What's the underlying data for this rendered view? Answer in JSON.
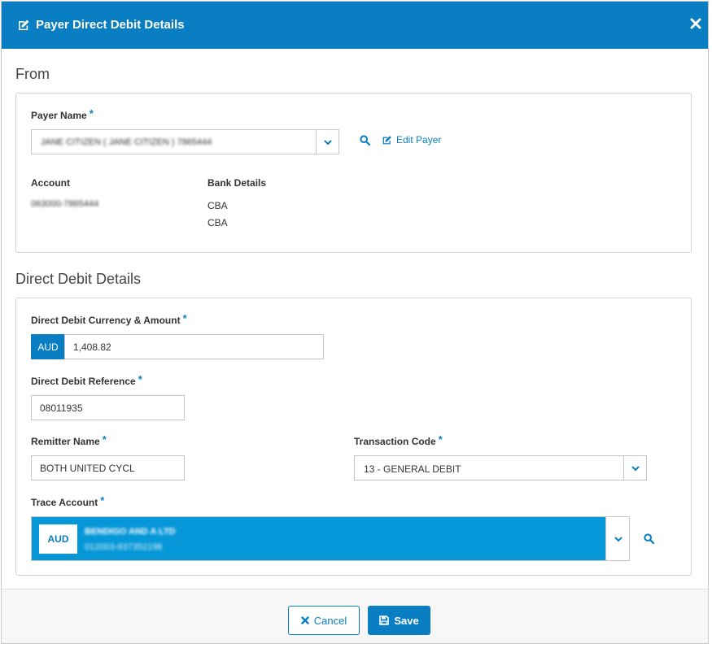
{
  "modal": {
    "title": "Payer Direct Debit Details",
    "accent_color": "#0a7ec2"
  },
  "from": {
    "section_title": "From",
    "payer_name_label": "Payer Name",
    "payer_name_value": "JANE CITIZEN ( JANE CITIZEN ) 7865444",
    "edit_payer_label": "Edit Payer",
    "account_label": "Account",
    "account_value": "063000-7865444",
    "bank_details_label": "Bank Details",
    "bank_line1": "CBA",
    "bank_line2": "CBA"
  },
  "direct_debit": {
    "section_title": "Direct Debit Details",
    "currency_amount_label": "Direct Debit Currency & Amount",
    "currency": "AUD",
    "amount": "1,408.82",
    "reference_label": "Direct Debit Reference",
    "reference_value": "08011935",
    "remitter_label": "Remitter Name",
    "remitter_value": "BOTH UNITED CYCL",
    "transaction_code_label": "Transaction Code",
    "transaction_code_value": "13 - GENERAL DEBIT",
    "trace_account_label": "Trace Account",
    "trace_currency": "AUD",
    "trace_name": "BENDIGO AND A LTD",
    "trace_number": "012003-837352198"
  },
  "footer": {
    "cancel_label": "Cancel",
    "save_label": "Save"
  },
  "required_marker": "*"
}
